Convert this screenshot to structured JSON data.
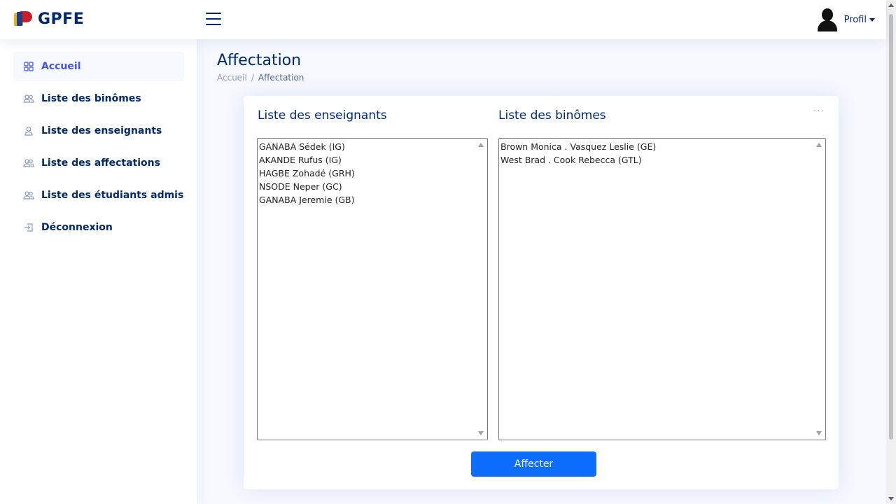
{
  "header": {
    "logo_text": "GPFE",
    "profile_label": "Profil"
  },
  "sidebar": {
    "items": [
      {
        "label": "Accueil",
        "icon": "grid-icon",
        "active": true
      },
      {
        "label": "Liste des binômes",
        "icon": "people-icon"
      },
      {
        "label": "Liste des enseignants",
        "icon": "person-icon"
      },
      {
        "label": "Liste des affectations",
        "icon": "people-icon"
      },
      {
        "label": "Liste des étudiants admis",
        "icon": "people-icon"
      },
      {
        "label": "Déconnexion",
        "icon": "box-arrow-in-right-icon"
      }
    ]
  },
  "page": {
    "title": "Affectation",
    "breadcrumb": [
      "Accueil",
      "Affectation"
    ]
  },
  "card": {
    "teachers_title": "Liste des enseignants",
    "binomes_title": "Liste des binômes",
    "teachers": [
      "GANABA Sédek (IG)",
      "AKANDE Rufus (IG)",
      "HAGBE Zohadé (GRH)",
      "NSODE Neper (GC)",
      "GANABA Jeremie (GB)"
    ],
    "binomes": [
      "Brown Monica . Vasquez Leslie (GE)",
      "West Brad . Cook Rebecca (GTL)"
    ],
    "button_label": "Affecter"
  },
  "colors": {
    "primary": "#012970",
    "accent": "#4154f1",
    "button": "#0d6efd",
    "background": "#f6f9ff"
  }
}
